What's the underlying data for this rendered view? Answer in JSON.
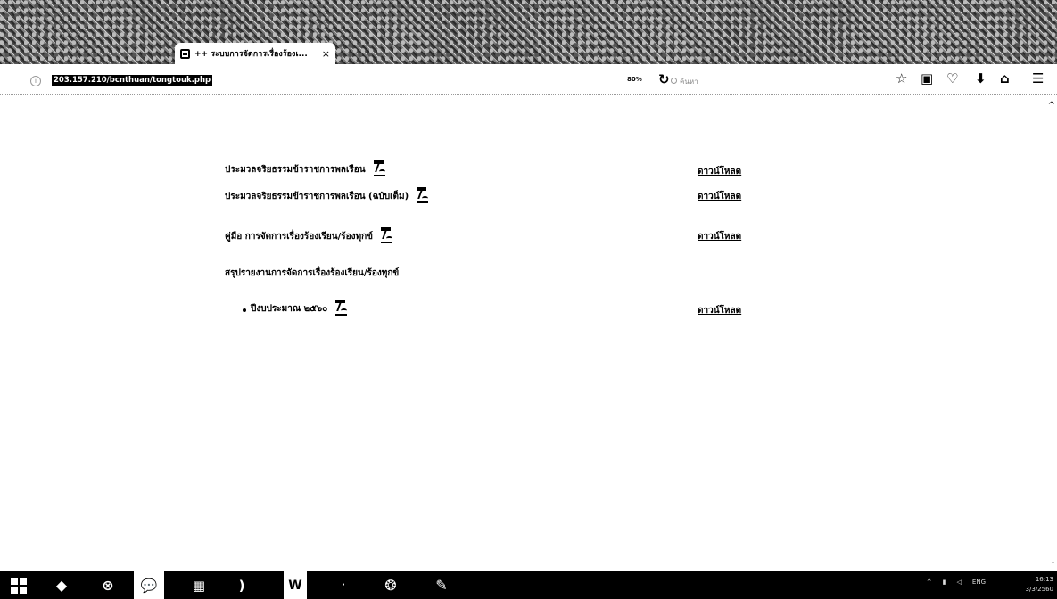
{
  "browser": {
    "tab_title": "++ ระบบการจัดการเรื่องร้องเ...",
    "tab_close": "×",
    "url": "203.157.210/bcnthuan/tongtouk.php",
    "zoom": "80%",
    "search_placeholder": "ค้นหา",
    "toolbar_icons": [
      "bookmark-star-icon",
      "reading-list-icon",
      "pocket-icon",
      "download-icon",
      "home-icon",
      "menu-icon"
    ]
  },
  "content": {
    "items": [
      {
        "label": "ประมวลจริยธรรมข้าราชการพลเรือน",
        "link": "ดาวน์โหลด"
      },
      {
        "label": "ประมวลจริยธรรมข้าราชการพลเรือน (ฉบับเต็ม)",
        "link": "ดาวน์โหลด"
      },
      {
        "label": "คู่มือ การจัดการเรื่องร้องเรียน/ร้องทุกข์",
        "link": "ดาวน์โหลด"
      }
    ],
    "section_heading": "สรุปรายงานการจัดการเรื่องร้องเรียน/ร้องทุกข์",
    "sub_item": {
      "label": "ปีงบประมาณ ๒๕๖๐",
      "link": "ดาวน์โหลด"
    }
  },
  "taskbar": {
    "apps": [
      "start-windows-icon",
      "browser-icon",
      "xbox-icon",
      "line-icon",
      "file-explorer-icon",
      "media-icon",
      "word-icon",
      "app-icon",
      "photo-icon",
      "paint-icon"
    ],
    "clock_time": "16:13",
    "clock_date": "3/3/2560",
    "language": "ENG"
  }
}
